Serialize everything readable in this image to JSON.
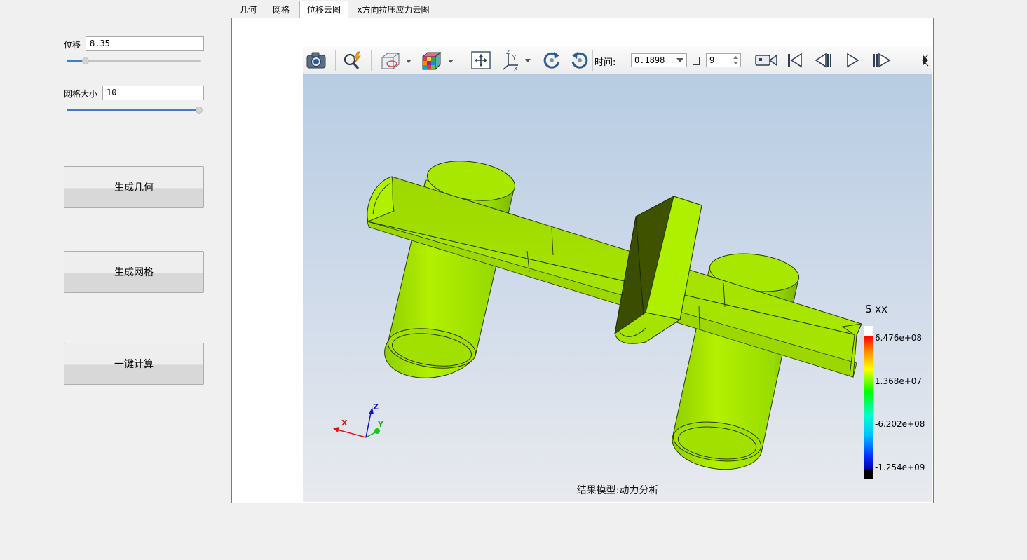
{
  "tabs": [
    {
      "label": "几何",
      "active": false
    },
    {
      "label": "网格",
      "active": false
    },
    {
      "label": "位移云图",
      "active": true
    },
    {
      "label": "x方向拉压应力云图",
      "active": false
    }
  ],
  "left_panel": {
    "displacement": {
      "label": "位移",
      "value": "8.35",
      "slider_fraction": 0.14
    },
    "mesh_size": {
      "label": "网格大小",
      "value": "10",
      "slider_fraction": 1.0
    },
    "buttons": {
      "gen_geometry": "生成几何",
      "gen_mesh": "生成网格",
      "one_click": "一键计算"
    }
  },
  "toolbar": {
    "time_label": "时间:",
    "time_value": "0.1898",
    "frame_value": "9",
    "icons": [
      "camera-icon",
      "probe-icon",
      "display-mode-icon",
      "color-cube-icon",
      "fit-view-icon",
      "axes-icon",
      "rotate-cw-icon",
      "rotate-ccw-icon",
      "video-record-icon",
      "first-frame-icon",
      "prev-frame-icon",
      "play-icon",
      "next-frame-icon"
    ]
  },
  "viewport": {
    "model_caption": "结果模型:动力分析",
    "legend": {
      "title": "S xx",
      "labels": [
        "6.476e+08",
        "1.368e+07",
        "-6.202e+08",
        "-1.254e+09"
      ]
    },
    "axes": {
      "x": "X",
      "y": "Y",
      "z": "Z"
    },
    "colors": {
      "part": "#a6e800",
      "part_dark": "#6e9a00",
      "part_shadow": "#3d5200"
    }
  }
}
